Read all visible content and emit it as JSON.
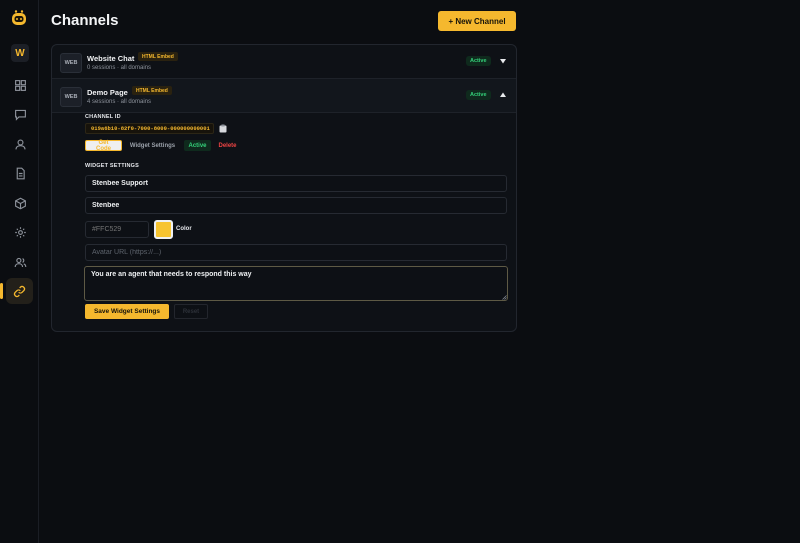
{
  "sidebar": {
    "workspace_initial": "W",
    "icons": [
      "logo-icon",
      "dashboard-icon",
      "chat-icon",
      "user-icon",
      "document-icon",
      "cube-icon",
      "gear-icon",
      "users-icon",
      "link-icon"
    ],
    "active": "link-icon"
  },
  "header": {
    "title": "Channels",
    "new_channel_label": "+ New Channel"
  },
  "channels": [
    {
      "badge": "WEB",
      "name": "Website Chat",
      "tag": "HTML Embed",
      "subtitle": "0 sessions · all domains",
      "status": "Active",
      "expanded": false
    },
    {
      "badge": "WEB",
      "name": "Demo Page",
      "tag": "HTML Embed",
      "subtitle": "4 sessions · all domains",
      "status": "Active",
      "expanded": true
    }
  ],
  "detail": {
    "channel_id_label": "CHANNEL ID",
    "channel_id": "019a6b10-82f0-7000-8000-000000000001",
    "actions": {
      "get_code": "Get Code",
      "widget_settings": "Widget Settings",
      "active": "Active",
      "delete": "Delete"
    },
    "widget_settings_label": "WIDGET SETTINGS",
    "title_value": "Stenbee Support",
    "name_value": "Stenbee",
    "color_placeholder": "#FFC529",
    "color_value": "#f7c430",
    "color_label": "Color",
    "avatar_placeholder": "Avatar URL (https://...)",
    "prompt_value": "You are an agent that needs to respond this way",
    "save_label": "Save Widget Settings",
    "reset_label": "Reset"
  },
  "colors": {
    "accent": "#f5b82e",
    "success": "#34d27a",
    "danger": "#ef4444",
    "background": "#0b0d11"
  }
}
